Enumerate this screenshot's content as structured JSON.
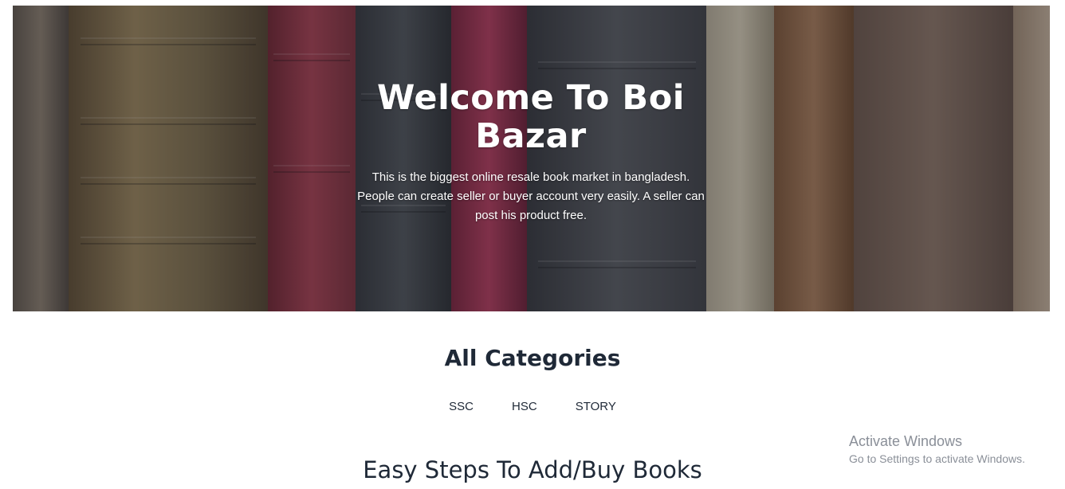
{
  "hero": {
    "title": "Welcome To Boi Bazar",
    "description": "This is the biggest online resale book market in bangladesh. People can create seller or buyer account very easily. A seller can post his product free."
  },
  "categories": {
    "title": "All Categories",
    "items": [
      {
        "label": "SSC"
      },
      {
        "label": "HSC"
      },
      {
        "label": "STORY"
      }
    ]
  },
  "steps": {
    "title": "Easy Steps To Add/Buy Books"
  },
  "watermark": {
    "title": "Activate Windows",
    "subtitle": "Go to Settings to activate Windows."
  },
  "colors": {
    "text_dark": "#1f2937",
    "watermark": "#8a8f98",
    "hero_overlay": "rgba(40,40,50,0.38)"
  }
}
